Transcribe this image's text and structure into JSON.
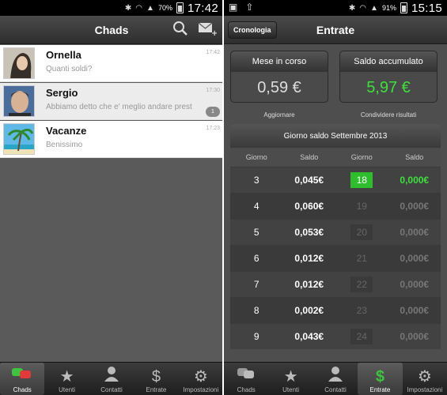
{
  "left": {
    "status": {
      "battery": "70%",
      "time": "17:42"
    },
    "title": "Chads",
    "chats": [
      {
        "name": "Ornella",
        "preview": "Quanti soldi?",
        "time": "17:42",
        "badge": ""
      },
      {
        "name": "Sergio",
        "preview": "Abbiamo detto che e' meglio andare prest",
        "time": "17:30",
        "badge": "1"
      },
      {
        "name": "Vacanze",
        "preview": "Benissimo",
        "time": "17:23",
        "badge": ""
      }
    ],
    "nav": [
      {
        "label": "Chads",
        "icon": "chat-bubbles-icon",
        "glyph": "💬"
      },
      {
        "label": "Utenti",
        "icon": "star-icon",
        "glyph": "★"
      },
      {
        "label": "Contatti",
        "icon": "person-icon",
        "glyph": "👤"
      },
      {
        "label": "Entrate",
        "icon": "dollar-icon",
        "glyph": "$"
      },
      {
        "label": "Impostazioni",
        "icon": "gear-icon",
        "glyph": "⚙"
      }
    ]
  },
  "right": {
    "status": {
      "battery": "91%",
      "time": "15:15"
    },
    "title": "Entrate",
    "history_button": "Cronologia",
    "card_month": {
      "title": "Mese in corso",
      "value": "0,59 €"
    },
    "card_total": {
      "title": "Saldo accumulato",
      "value": "5,97 €"
    },
    "refresh_label": "Aggiornare",
    "share_label": "Condividere risultati",
    "table_title": "Giorno saldo Settembre 2013",
    "col_headers": [
      "Giorno",
      "Saldo",
      "Giorno",
      "Saldo"
    ],
    "rows": [
      {
        "d1": "3",
        "s1": "0,045€",
        "d2": "18",
        "s2": "0,000€"
      },
      {
        "d1": "4",
        "s1": "0,060€",
        "d2": "19",
        "s2": "0,000€"
      },
      {
        "d1": "5",
        "s1": "0,053€",
        "d2": "20",
        "s2": "0,000€"
      },
      {
        "d1": "6",
        "s1": "0,012€",
        "d2": "21",
        "s2": "0,000€"
      },
      {
        "d1": "7",
        "s1": "0,012€",
        "d2": "22",
        "s2": "0,000€"
      },
      {
        "d1": "8",
        "s1": "0,002€",
        "d2": "23",
        "s2": "0,000€"
      },
      {
        "d1": "9",
        "s1": "0,043€",
        "d2": "24",
        "s2": "0,000€"
      }
    ],
    "nav": [
      {
        "label": "Chads",
        "icon": "chat-bubbles-icon",
        "glyph": "💬"
      },
      {
        "label": "Utenti",
        "icon": "star-icon",
        "glyph": "★"
      },
      {
        "label": "Contatti",
        "icon": "person-icon",
        "glyph": "👤"
      },
      {
        "label": "Entrate",
        "icon": "dollar-icon",
        "glyph": "$"
      },
      {
        "label": "Impostazioni",
        "icon": "gear-icon",
        "glyph": "⚙"
      }
    ]
  },
  "colors": {
    "accent_green": "#2dbd2d",
    "value_green": "#3ee03e",
    "bar_dark": "#2e2e2e"
  }
}
